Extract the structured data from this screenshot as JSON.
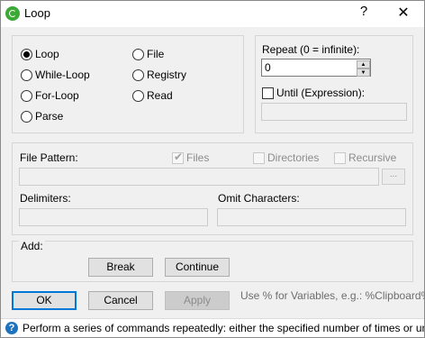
{
  "window": {
    "title": "Loop",
    "help_label": "?",
    "close_label": "✕"
  },
  "loop_type": {
    "options": [
      "Loop",
      "While-Loop",
      "For-Loop",
      "Parse",
      "File",
      "Registry",
      "Read"
    ],
    "selected": "Loop"
  },
  "repeat": {
    "label": "Repeat (0 = infinite):",
    "value": "0",
    "until_label": "Until (Expression):",
    "until_checked": false,
    "until_value": ""
  },
  "file": {
    "pattern_label": "File Pattern:",
    "files_label": "Files",
    "files_checked": true,
    "directories_label": "Directories",
    "directories_checked": false,
    "recursive_label": "Recursive",
    "recursive_checked": false,
    "pattern_value": "",
    "browse_label": "...",
    "delimiters_label": "Delimiters:",
    "delimiters_value": "",
    "omit_label": "Omit Characters:",
    "omit_value": ""
  },
  "add": {
    "label": "Add:",
    "break_label": "Break",
    "continue_label": "Continue"
  },
  "footer": {
    "ok_label": "OK",
    "cancel_label": "Cancel",
    "apply_label": "Apply",
    "hint": "Use % for Variables, e.g.: %Clipboard%"
  },
  "status": {
    "text": "Perform a series of commands repeatedly: either the specified number of times or until break is e"
  }
}
